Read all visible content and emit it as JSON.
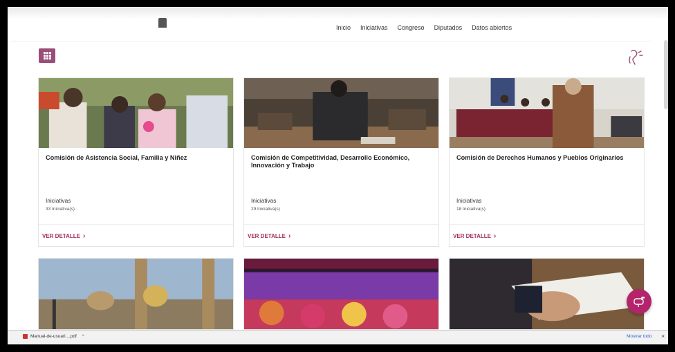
{
  "nav": {
    "links": [
      "Inicio",
      "Iniciativas",
      "Congreso",
      "Diputados",
      "Datos abiertos"
    ]
  },
  "cards": [
    {
      "title": "Comisión de Asistencia Social, Familia y Niñez",
      "subtitle": "Iniciativas",
      "count": "33 Iniciativa(s)",
      "action": "VER DETALLE"
    },
    {
      "title": "Comisión de Competitividad, Desarrollo Económico, Innovación y Trabajo",
      "subtitle": "Iniciativas",
      "count": "29 Iniciativa(s)",
      "action": "VER DETALLE"
    },
    {
      "title": "Comisión de Derechos Humanos y Pueblos Originarios",
      "subtitle": "Iniciativas",
      "count": "18 Iniciativa(s)",
      "action": "VER DETALLE"
    }
  ],
  "download_bar": {
    "file_name": "Manual-de-usuari....pdf",
    "show_all": "Mostrar todo"
  },
  "colors": {
    "accent": "#9a4d79",
    "link": "#a32d5c",
    "fab": "#b3246b"
  }
}
